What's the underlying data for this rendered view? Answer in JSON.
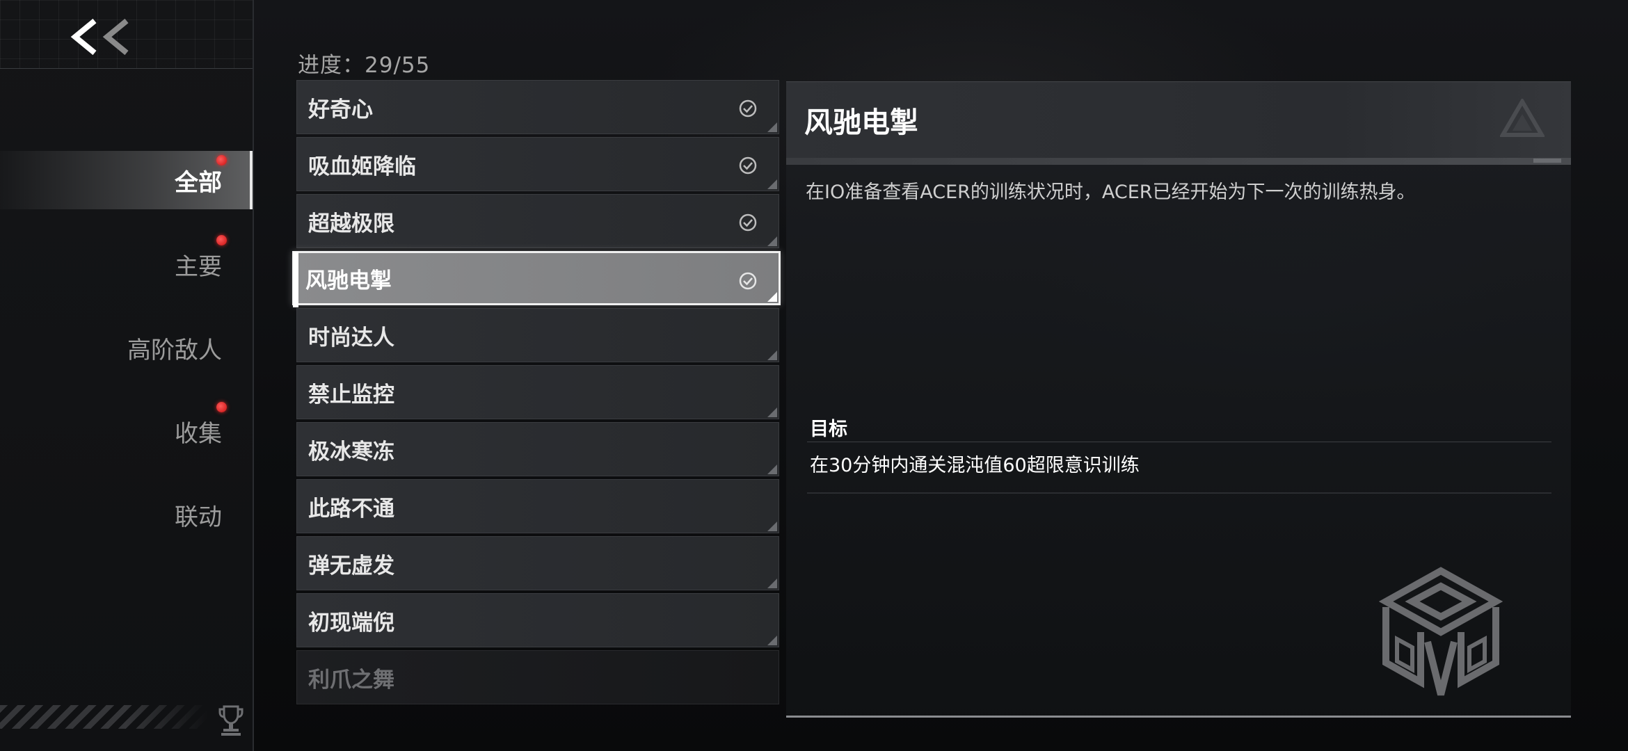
{
  "sidebar": {
    "back_icon": "double-chevron-left-icon",
    "items": [
      {
        "label": "全部",
        "active": true,
        "badge": true
      },
      {
        "label": "主要",
        "active": false,
        "badge": true
      },
      {
        "label": "高阶敌人",
        "active": false,
        "badge": false
      },
      {
        "label": "收集",
        "active": false,
        "badge": true
      },
      {
        "label": "联动",
        "active": false,
        "badge": false
      }
    ],
    "footer_icon": "trophy-icon"
  },
  "progress": {
    "text": "进度：29/55"
  },
  "achievements": [
    {
      "label": "好奇心",
      "completed": true
    },
    {
      "label": "吸血姬降临",
      "completed": true
    },
    {
      "label": "超越极限",
      "completed": true
    },
    {
      "label": "风驰电掣",
      "completed": true,
      "selected": true
    },
    {
      "label": "时尚达人",
      "completed": false
    },
    {
      "label": "禁止监控",
      "completed": false
    },
    {
      "label": "极冰寒冻",
      "completed": false
    },
    {
      "label": "此路不通",
      "completed": false
    },
    {
      "label": "弹无虚发",
      "completed": false
    },
    {
      "label": "初现端倪",
      "completed": false
    },
    {
      "label": "利爪之舞",
      "completed": false
    }
  ],
  "detail": {
    "title": "风驰电掣",
    "description": "在IO准备查看ACER的训练状况时，ACER已经开始为下一次的训练热身。",
    "goal_label": "目标",
    "goal_text": "在30分钟内通关混沌值60超限意识训练",
    "header_icon": "triangle-logo-icon",
    "emblem_icon": "faction-emblem-icon"
  },
  "colors": {
    "badge": "#e0191b",
    "background": "#0d0e10",
    "selected_fill": "#858688"
  }
}
